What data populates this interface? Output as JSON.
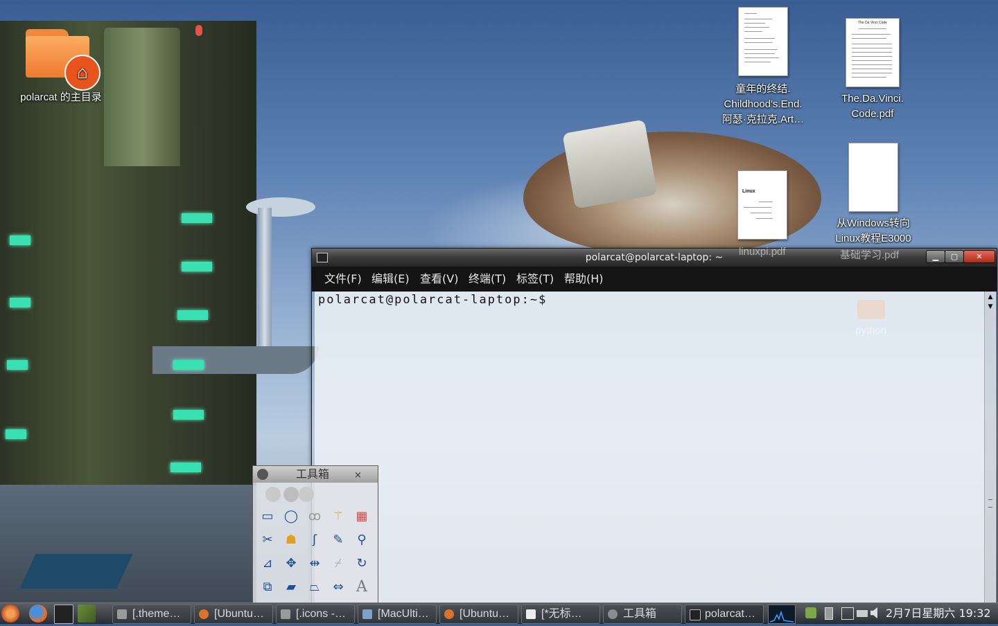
{
  "desktop": {
    "home_icon_label": "polarcat 的主目录",
    "files": [
      {
        "label_lines": [
          "童年的终结.",
          "Childhood's.End.",
          "阿瑟·克拉克.Art…"
        ],
        "icon": "pdf-document-icon",
        "thumb_title": ""
      },
      {
        "label_lines": [
          "The.Da.Vinci.",
          "Code.pdf"
        ],
        "icon": "pdf-document-icon",
        "thumb_title": "The Da Vinci Code"
      },
      {
        "label_lines": [
          "linuxpi.pdf"
        ],
        "icon": "pdf-document-icon",
        "thumb_title": "Linux"
      },
      {
        "label_lines": [
          "从Windows转向",
          "Linux教程E3000",
          "基础学习.pdf"
        ],
        "icon": "pdf-document-icon",
        "thumb_title": ""
      },
      {
        "label_lines": [
          "python"
        ],
        "icon": "folder-icon",
        "thumb_title": ""
      }
    ]
  },
  "terminal": {
    "title": "polarcat@polarcat-laptop: ~",
    "menu": [
      "文件(F)",
      "编辑(E)",
      "查看(V)",
      "终端(T)",
      "标签(T)",
      "帮助(H)"
    ],
    "prompt": "polarcat@polarcat-laptop:~$",
    "window_buttons": {
      "minimize": "▁",
      "maximize": "▢",
      "close": "✕"
    }
  },
  "toolbox": {
    "title": "工具箱",
    "close": "×",
    "tools": [
      "rect-select-icon",
      "ellipse-select-icon",
      "free-select-icon",
      "fuzzy-select-icon",
      "color-select-icon",
      "scissors-icon",
      "foreground-select-icon",
      "paths-icon",
      "color-picker-icon",
      "zoom-icon",
      "measure-icon",
      "move-icon",
      "align-icon",
      "crop-icon",
      "rotate-icon",
      "scale-icon",
      "shear-icon",
      "perspective-icon",
      "flip-icon",
      "text-icon"
    ],
    "text_tool_glyph": "A"
  },
  "panel": {
    "launchers": [
      "ubuntu-menu-icon",
      "firefox-icon",
      "terminal-icon",
      "book-icon"
    ],
    "tasks": [
      {
        "label": "[.theme…",
        "icon": "folder-icon"
      },
      {
        "label": "[Ubuntu…",
        "icon": "firefox-icon"
      },
      {
        "label": "[.icons -…",
        "icon": "folder-icon"
      },
      {
        "label": "[MacUlti…",
        "icon": "image-viewer-icon"
      },
      {
        "label": "[Ubuntu…",
        "icon": "firefox-icon"
      },
      {
        "label": "[*无标…",
        "icon": "text-editor-icon"
      },
      {
        "label": "工具箱",
        "icon": "gimp-icon"
      },
      {
        "label": "polarcat…",
        "icon": "terminal-icon"
      }
    ],
    "tray": [
      "system-monitor-icon",
      "update-icon",
      "battery-icon",
      "network-icon",
      "display-icon",
      "volume-icon"
    ],
    "clock": "2月7日星期六 19:32"
  },
  "colors": {
    "terminal_title": "#3b3b3b",
    "terminal_menubar": "#141414",
    "terminal_bg": "#ecf1f6",
    "close_button": "#c7402e",
    "panel": "#2a2e33"
  }
}
